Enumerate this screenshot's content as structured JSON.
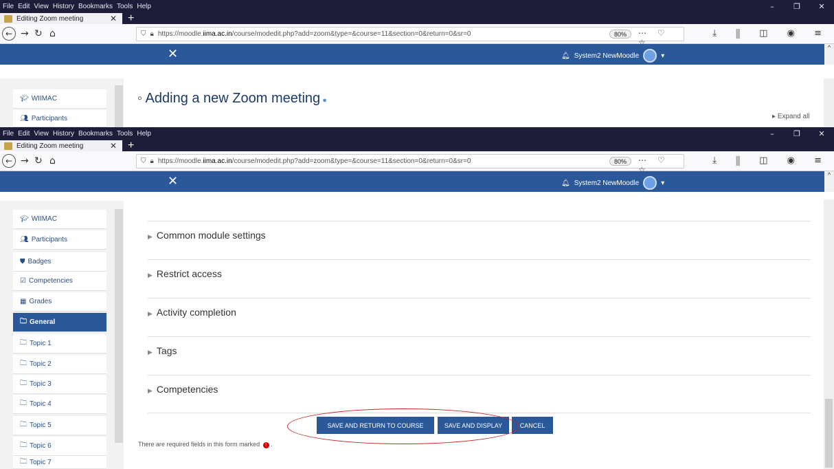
{
  "menu": [
    "File",
    "Edit",
    "View",
    "History",
    "Bookmarks",
    "Tools",
    "Help"
  ],
  "tab_title": "Editing Zoom meeting",
  "url_prefix": "https://moodle.",
  "url_host": "iima.ac.in",
  "url_path": "/course/modedit.php?add=zoom&type=&course=11&section=0&return=0&sr=0",
  "zoom_level": "80%",
  "user_name": "System2 NewMoodle",
  "page_title": "Adding a new Zoom meeting",
  "expand_all": "Expand all",
  "top_nav": [
    "WIIMAC",
    "Participants"
  ],
  "nav": [
    "WIIMAC",
    "Participants",
    "Badges",
    "Competencies",
    "Grades",
    "General",
    "Topic 1",
    "Topic 2",
    "Topic 3",
    "Topic 4",
    "Topic 5",
    "Topic 6",
    "Topic 7"
  ],
  "nav_icons": [
    "graduation-cap-icon",
    "users-icon",
    "shield-icon",
    "check-square-icon",
    "table-icon",
    "folder-icon",
    "folder-icon",
    "folder-icon",
    "folder-icon",
    "folder-icon",
    "folder-icon",
    "folder-icon",
    "folder-icon"
  ],
  "sections": [
    "Common module settings",
    "Restrict access",
    "Activity completion",
    "Tags",
    "Competencies"
  ],
  "buttons": {
    "save_return": "SAVE AND RETURN TO COURSE",
    "save_display": "SAVE AND DISPLAY",
    "cancel": "CANCEL"
  },
  "required_text": "There are required fields in this form marked"
}
